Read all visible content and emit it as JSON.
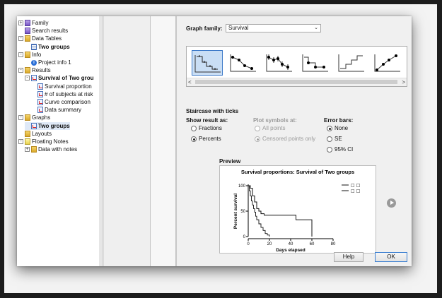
{
  "tree": {
    "items": [
      {
        "label": "Family",
        "icon": "folder-purple-icon",
        "bold": false
      },
      {
        "label": "Search results",
        "icon": "folder-purple-icon",
        "bold": false
      },
      {
        "label": "Data Tables",
        "icon": "folder-icon",
        "bold": false
      },
      {
        "label": "Two groups",
        "icon": "data-table-icon",
        "bold": true
      },
      {
        "label": "Info",
        "icon": "folder-icon",
        "bold": false
      },
      {
        "label": "Project info 1",
        "icon": "info-icon",
        "bold": false
      },
      {
        "label": "Results",
        "icon": "folder-icon",
        "bold": false
      },
      {
        "label": "Survival of Two grou",
        "icon": "results-icon",
        "bold": true
      },
      {
        "label": "Survival proportion",
        "icon": "results-icon",
        "bold": false
      },
      {
        "label": "# of subjects at risk",
        "icon": "results-icon",
        "bold": false
      },
      {
        "label": "Curve comparison",
        "icon": "results-icon",
        "bold": false
      },
      {
        "label": "Data summary",
        "icon": "results-icon",
        "bold": false
      },
      {
        "label": "Graphs",
        "icon": "folder-icon",
        "bold": false
      },
      {
        "label": "Two groups",
        "icon": "graph-icon",
        "bold": true
      },
      {
        "label": "Layouts",
        "icon": "folder-icon",
        "bold": false
      },
      {
        "label": "Floating Notes",
        "icon": "notes-icon",
        "bold": false
      },
      {
        "label": "Data with notes",
        "icon": "folder-icon",
        "bold": false
      }
    ]
  },
  "dialog": {
    "graph_family_label": "Graph family:",
    "graph_family_value": "Survival",
    "graph_type_title": "Staircase with ticks",
    "show_result": {
      "heading": "Show result as:",
      "options": [
        "Fractions",
        "Percents"
      ],
      "selected": "Percents"
    },
    "plot_symbols": {
      "heading": "Plot symbols at:",
      "options": [
        "All points",
        "Censored points only"
      ],
      "selected": "Censored points only"
    },
    "error_bars": {
      "heading": "Error bars:",
      "options": [
        "None",
        "SE",
        "95% CI"
      ],
      "selected": "None"
    },
    "preview_label": "Preview",
    "help_button": "Help",
    "ok_button": "OK",
    "scroll_left": "<",
    "scroll_right": ">"
  },
  "chart_data": {
    "type": "line",
    "title": "Survival proportions: Survival of Two groups",
    "xlabel": "Days elapsed",
    "ylabel": "Percent survival",
    "xlim": [
      0,
      80
    ],
    "ylim": [
      0,
      100
    ],
    "xticks": [
      0,
      20,
      40,
      60,
      80
    ],
    "yticks": [
      0,
      50,
      100
    ],
    "legend": [
      "□ □",
      "□ □"
    ],
    "series": [
      {
        "x": [
          0,
          2,
          4,
          6,
          8,
          10,
          12,
          15,
          20,
          30,
          40,
          45,
          60,
          60
        ],
        "y": [
          100,
          95,
          80,
          68,
          55,
          50,
          45,
          42,
          42,
          42,
          42,
          33,
          17,
          0
        ]
      },
      {
        "x": [
          0,
          1,
          2,
          3,
          4,
          5,
          6,
          7,
          8,
          10,
          12,
          14,
          16,
          18,
          20
        ],
        "y": [
          100,
          90,
          80,
          70,
          62,
          55,
          48,
          40,
          33,
          25,
          18,
          12,
          6,
          3,
          0
        ]
      }
    ]
  }
}
